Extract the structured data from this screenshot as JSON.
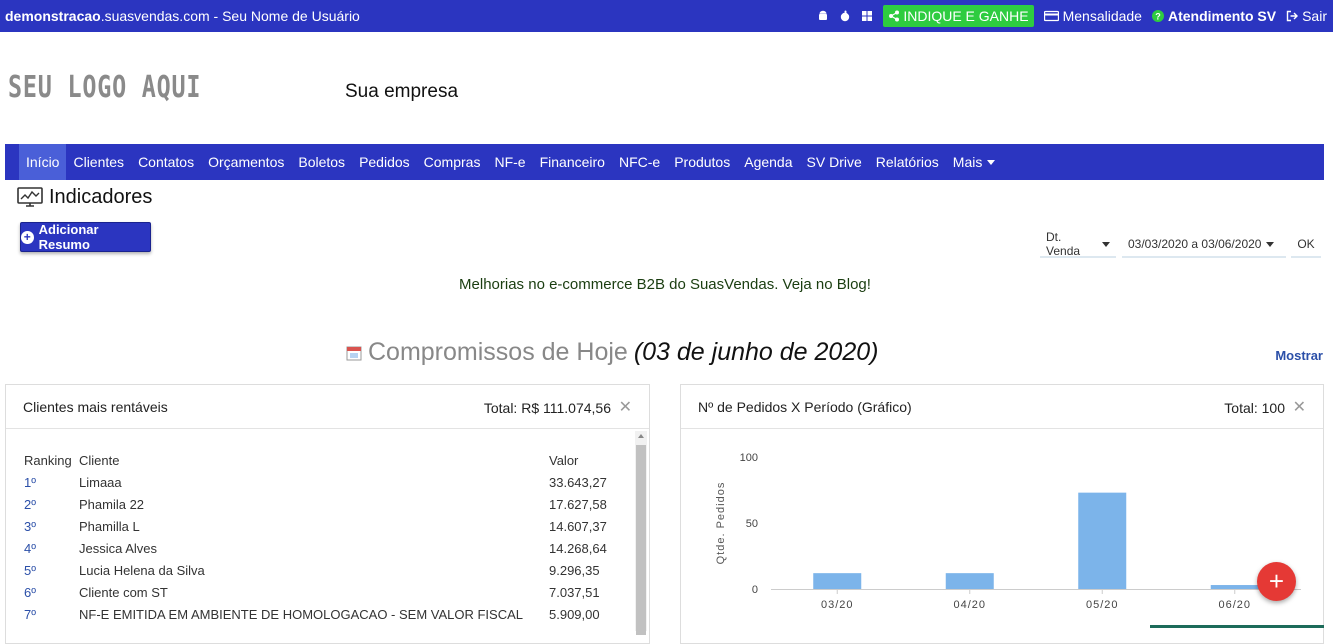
{
  "topbar": {
    "domain_bold": "demonstracao",
    "domain_rest": ".suasvendas.com",
    "user": " - Seu Nome de Usuário",
    "indique": "INDIQUE E GANHE",
    "mensalidade": "Mensalidade",
    "atendimento": "Atendimento SV",
    "sair": "Sair"
  },
  "header": {
    "logo": "SEU LOGO AQUI",
    "company": "Sua empresa"
  },
  "nav": [
    "Início",
    "Clientes",
    "Contatos",
    "Orçamentos",
    "Boletos",
    "Pedidos",
    "Compras",
    "NF-e",
    "Financeiro",
    "NFC-e",
    "Produtos",
    "Agenda",
    "SV Drive",
    "Relatórios",
    "Mais"
  ],
  "page": {
    "title": "Indicadores",
    "add_button": "Adicionar Resumo",
    "filter_type": "Dt. Venda",
    "filter_range": "03/03/2020 a 03/06/2020",
    "ok": "OK",
    "banner": "Melhorias no e-commerce B2B do SuasVendas. Veja no Blog!",
    "compromissos": "Compromissos de Hoje",
    "compromissos_date": "(03 de junho de 2020)",
    "mostrar": "Mostrar"
  },
  "clientes_panel": {
    "title": "Clientes mais rentáveis",
    "total": "Total: R$ 111.074,56",
    "headers": [
      "Ranking",
      "Cliente",
      "Valor"
    ],
    "rows": [
      [
        "1º",
        "Limaaa",
        "33.643,27"
      ],
      [
        "2º",
        "Phamila 22",
        "17.627,58"
      ],
      [
        "3º",
        "Phamilla L",
        "14.607,37"
      ],
      [
        "4º",
        "Jessica Alves",
        "14.268,64"
      ],
      [
        "5º",
        "Lucia Helena da Silva",
        "9.296,35"
      ],
      [
        "6º",
        "Cliente com ST",
        "7.037,51"
      ],
      [
        "7º",
        "NF-E EMITIDA EM AMBIENTE DE HOMOLOGACAO - SEM VALOR FISCAL",
        "5.909,00"
      ]
    ]
  },
  "pedidos_panel": {
    "title": "Nº de Pedidos X Período (Gráfico)",
    "total": "Total: 100"
  },
  "chart_data": {
    "type": "bar",
    "categories": [
      "03/20",
      "04/20",
      "05/20",
      "06/20"
    ],
    "values": [
      12,
      12,
      73,
      3
    ],
    "xlabel": "",
    "ylabel": "Qtde. Pedidos",
    "ylim": [
      0,
      100
    ],
    "yticks": [
      0,
      50,
      100
    ],
    "color": "#7cb4ea",
    "grid": false
  },
  "fab": "+",
  "colors": {
    "brand": "#2b35c0",
    "accent_green": "#2ecc40",
    "fab": "#e53935"
  }
}
